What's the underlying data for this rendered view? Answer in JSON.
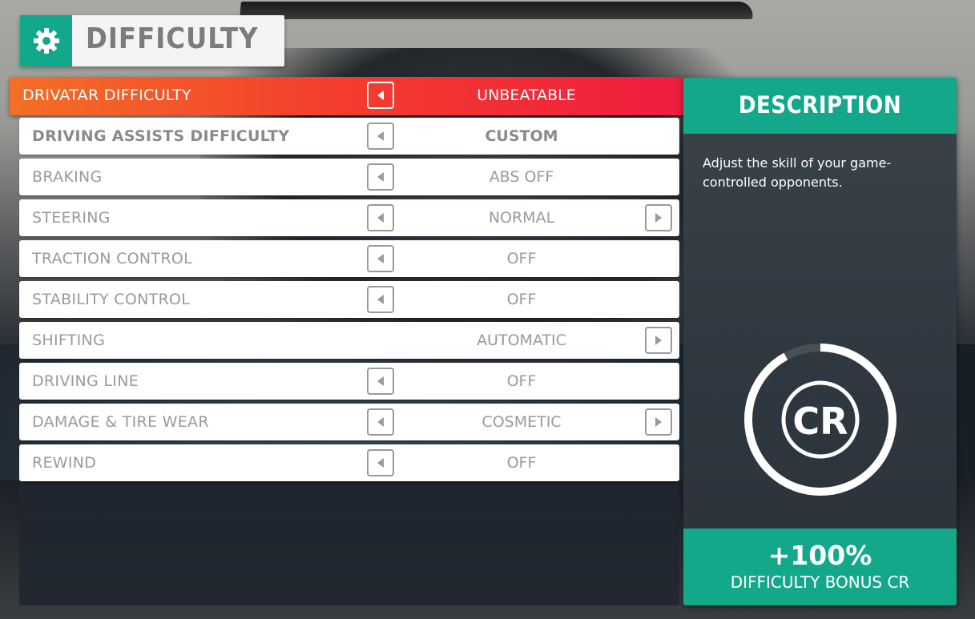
{
  "header": {
    "title": "DIFFICULTY",
    "icon": "gear-icon"
  },
  "settings": [
    {
      "label": "DRIVATAR DIFFICULTY",
      "value": "UNBEATABLE",
      "left_arrow": true,
      "right_arrow": false,
      "state": "selected"
    },
    {
      "label": "DRIVING ASSISTS DIFFICULTY",
      "value": "CUSTOM",
      "left_arrow": true,
      "right_arrow": false,
      "state": "bold"
    },
    {
      "label": "BRAKING",
      "value": "ABS OFF",
      "left_arrow": true,
      "right_arrow": false
    },
    {
      "label": "STEERING",
      "value": "NORMAL",
      "left_arrow": true,
      "right_arrow": true
    },
    {
      "label": "TRACTION CONTROL",
      "value": "OFF",
      "left_arrow": true,
      "right_arrow": false
    },
    {
      "label": "STABILITY CONTROL",
      "value": "OFF",
      "left_arrow": true,
      "right_arrow": false
    },
    {
      "label": "SHIFTING",
      "value": "AUTOMATIC",
      "left_arrow": false,
      "right_arrow": true
    },
    {
      "label": "DRIVING LINE",
      "value": "OFF",
      "left_arrow": true,
      "right_arrow": false
    },
    {
      "label": "DAMAGE & TIRE WEAR",
      "value": "COSMETIC",
      "left_arrow": true,
      "right_arrow": true
    },
    {
      "label": "REWIND",
      "value": "OFF",
      "left_arrow": true,
      "right_arrow": false
    }
  ],
  "description": {
    "title": "DESCRIPTION",
    "text": "Adjust the skill of your game-controlled opponents.",
    "badge_text": "CR",
    "bonus_value": "+100%",
    "bonus_label": "DIFFICULTY BONUS CR",
    "bonus_progress": 0.92
  },
  "colors": {
    "accent": "#14a88a",
    "selected_start": "#f36f26",
    "selected_end": "#ee1c3f",
    "row_bg": "#ffffff",
    "text_muted": "#9a9a9a"
  }
}
